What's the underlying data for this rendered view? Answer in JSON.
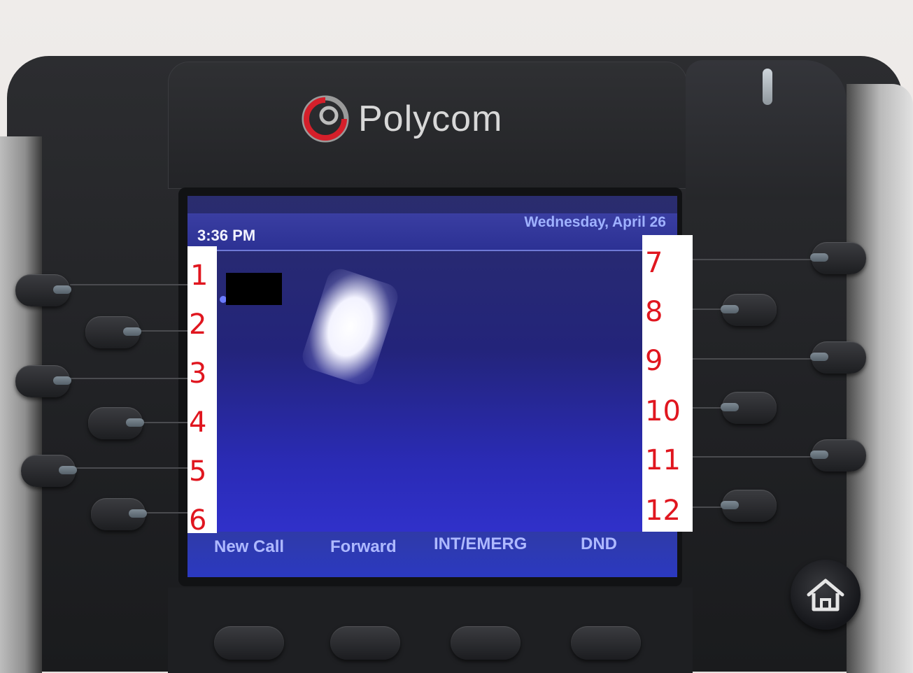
{
  "brand": {
    "name": "Polycom"
  },
  "status_bar": {
    "time": "3:36 PM",
    "date": "Wednesday, April 26"
  },
  "softkeys": [
    "New Call",
    "Forward",
    "INT/EMERG",
    "DND"
  ],
  "line_key_labels": {
    "left": [
      "1",
      "2",
      "3",
      "4",
      "5",
      "6"
    ],
    "right": [
      "7",
      "8",
      "9",
      "10",
      "11",
      "12"
    ]
  },
  "icons": {
    "home": "home-icon",
    "logo": "polycom-logo-icon"
  },
  "colors": {
    "screen": "#2a2bb5",
    "annotation": "#e0161f",
    "softkey_text": "#aeb9ff"
  }
}
